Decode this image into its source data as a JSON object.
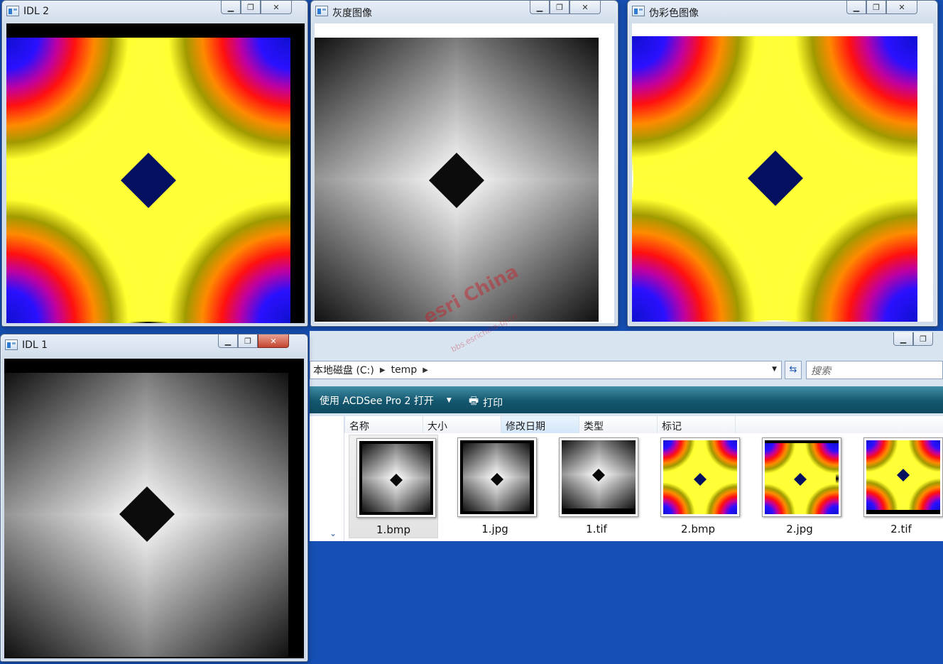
{
  "windows": {
    "idl2": {
      "title": "IDL 2"
    },
    "gray": {
      "title": "灰度图像"
    },
    "pseudo": {
      "title": "伪彩色图像"
    },
    "idl1": {
      "title": "IDL 1"
    }
  },
  "caption_icons": {
    "minimize": "minimize-icon",
    "maximize": "maximize-icon",
    "close": "close-icon"
  },
  "explorer": {
    "breadcrumb": [
      "本地磁盘 (C:)",
      "temp"
    ],
    "search_placeholder": "搜索",
    "toolbar": {
      "open_with": "使用 ACDSee Pro 2 打开",
      "print": "打印"
    },
    "columns": [
      "名称",
      "大小",
      "修改日期",
      "类型",
      "标记"
    ],
    "files": [
      {
        "name": "1.bmp",
        "kind": "gray",
        "selected": true
      },
      {
        "name": "1.jpg",
        "kind": "gray"
      },
      {
        "name": "1.tif",
        "kind": "gray"
      },
      {
        "name": "2.bmp",
        "kind": "color"
      },
      {
        "name": "2.jpg",
        "kind": "color"
      },
      {
        "name": "2.tif",
        "kind": "color"
      }
    ]
  },
  "watermark": {
    "text": "esri China",
    "sub": "bbs.esrichina-bj.cn"
  },
  "colors": {
    "desktop": "#1650b4",
    "toolbar": "#14576e"
  }
}
